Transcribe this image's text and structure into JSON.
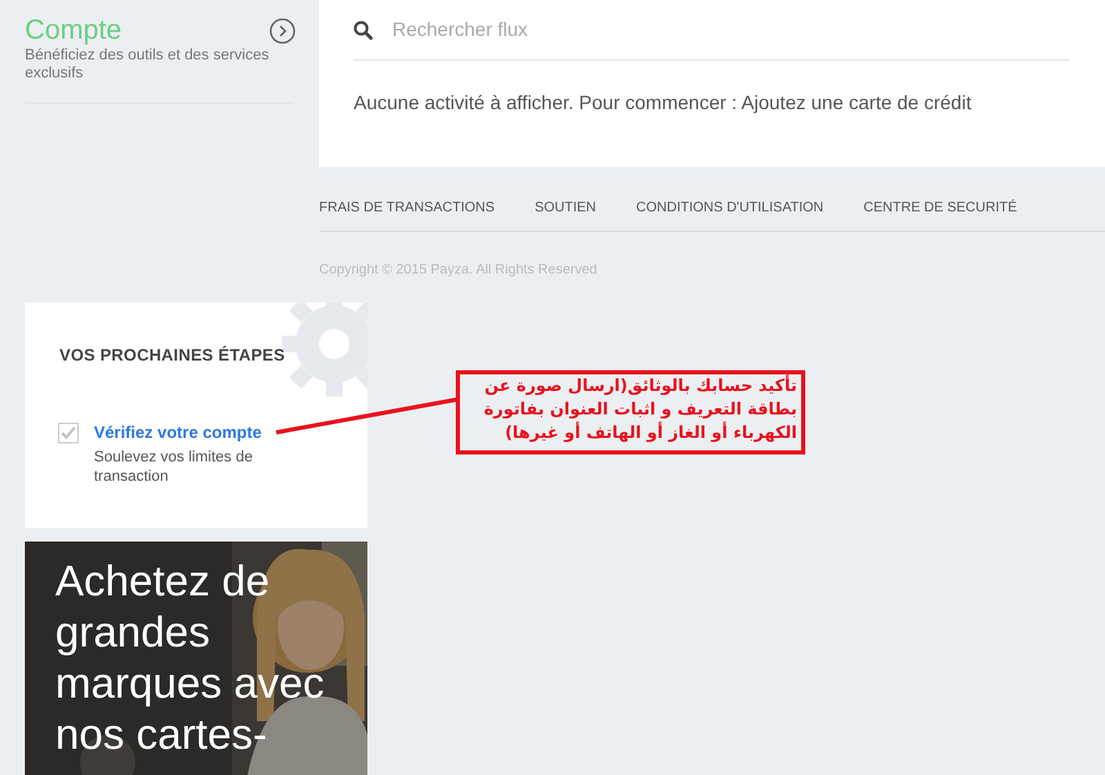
{
  "account": {
    "title": "Compte",
    "subtitle": "Bénéficiez des outils et des services exclusifs"
  },
  "search": {
    "placeholder": "Rechercher flux"
  },
  "activity_message": "Aucune activité à afficher. Pour commencer : Ajoutez une carte de crédit",
  "footer_links": [
    "FRAIS DE TRANSACTIONS",
    "SOUTIEN",
    "CONDITIONS D'UTILISATION",
    "CENTRE DE SECURITÉ"
  ],
  "copyright": "Copyright © 2015 Payza. All Rights Reserved",
  "next_steps": {
    "title": "VOS PROCHAINES ÉTAPES",
    "items": [
      {
        "label": "Vérifiez votre compte",
        "description": "Soulevez vos limites de transaction",
        "checked": true
      }
    ]
  },
  "promo": {
    "kind": "picture",
    "headline_lines": [
      "Achetez de",
      "grandes",
      "marques avec",
      "nos cartes-"
    ]
  },
  "annotation": {
    "text": "تأكيد حسابك بالوثائق(ارسال صورة عن بطاقة التعريف و اثبات العنوان بفاتورة الكهرباء أو الغاز أو الهاتف أو غيرها)"
  }
}
